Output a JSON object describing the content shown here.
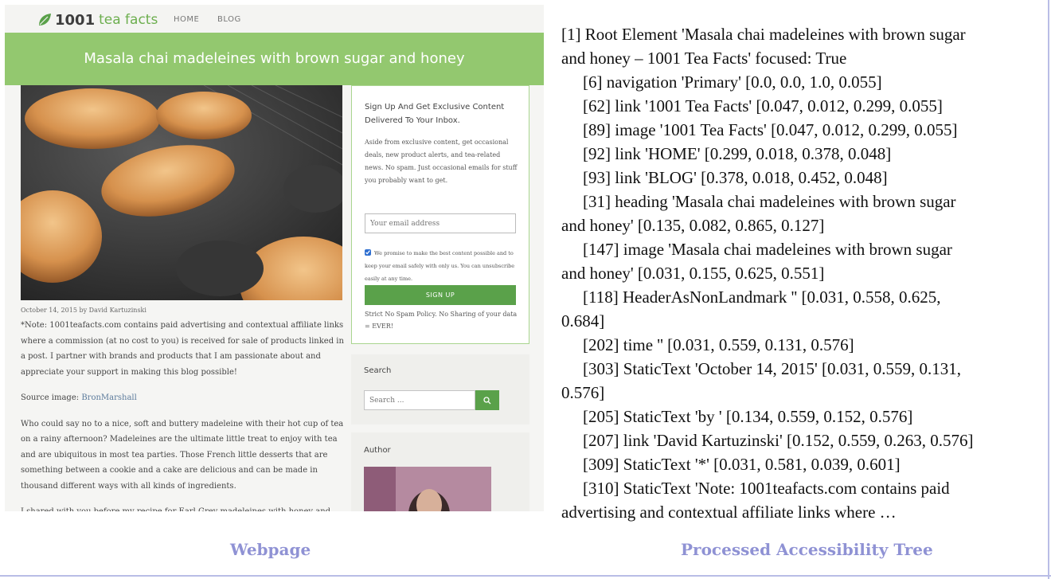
{
  "web": {
    "logo": {
      "number": "1001",
      "word": "tea facts"
    },
    "nav": {
      "home": "HOME",
      "blog": "BLOG"
    },
    "heading": "Masala chai madeleines with brown sugar and honey",
    "meta": {
      "date": "October 14, 2015",
      "by": " by ",
      "author": "David Kartuzinski"
    },
    "article": {
      "note": "*Note: 1001teafacts.com contains paid advertising and contextual affiliate links where a commission (at no cost to you) is received for sale of products linked in a post. I partner with brands and products that I am passionate about and appreciate your support in making this blog possible!",
      "source_label": "Source image: ",
      "source_link": "BronMarshall",
      "p2": "Who could say no to a nice, soft and buttery madeleine with their hot cup of tea on a rainy afternoon? Madeleines are the ultimate little treat to enjoy with tea and are ubiquitous in most tea parties. Those French little desserts that are something between a cookie and a cake are delicious and can be made in thousand different ways with all kinds of ingredients.",
      "p3": "I shared with you before my recipe for Earl Grey madeleines with honey and"
    },
    "signup": {
      "title": "Sign Up And Get Exclusive Content Delivered To Your Inbox.",
      "desc": "Aside from exclusive content, get occasional deals, new product alerts, and tea-related news. No spam. Just occasional emails for stuff you probably want to get.",
      "email_placeholder": "Your email address",
      "consent": "We promise to make the best content possible and to keep your email safely with only us. You can unsubscribe easily at any time.",
      "button": "SIGN UP",
      "spam_note": "Strict No Spam Policy. No Sharing of your data = EVER!"
    },
    "search": {
      "title": "Search",
      "placeholder": "Search ..."
    },
    "author": {
      "title": "Author"
    }
  },
  "captions": {
    "left": "Webpage",
    "right": "Processed Accessibility Tree"
  },
  "tree": {
    "lines": [
      "[1] Root Element 'Masala chai madeleines with brown sugar",
      "and honey – 1001 Tea Facts' focused: True",
      "[6] navigation 'Primary' [0.0, 0.0, 1.0, 0.055]",
      "[62] link '1001 Tea Facts' [0.047, 0.012, 0.299, 0.055]",
      "[89] image '1001 Tea Facts' [0.047, 0.012, 0.299, 0.055]",
      "[92] link 'HOME' [0.299, 0.018, 0.378, 0.048]",
      "[93] link 'BLOG' [0.378, 0.018, 0.452, 0.048]",
      "[31] heading 'Masala chai madeleines with brown sugar",
      "and honey' [0.135, 0.082, 0.865, 0.127]",
      "[147] image 'Masala chai madeleines with brown sugar",
      "and honey' [0.031, 0.155, 0.625, 0.551]",
      "[118] HeaderAsNonLandmark '' [0.031, 0.558, 0.625,",
      "0.684]",
      "[202] time '' [0.031, 0.559, 0.131, 0.576]",
      "[303] StaticText 'October 14, 2015' [0.031, 0.559, 0.131,",
      "0.576]",
      "[205] StaticText 'by ' [0.134, 0.559, 0.152, 0.576]",
      "[207] link 'David Kartuzinski' [0.152, 0.559, 0.263, 0.576]",
      "[309] StaticText '*' [0.031, 0.581, 0.039, 0.601]",
      "[310] StaticText 'Note: 1001teafacts.com contains paid",
      "advertising and contextual affiliate links where …"
    ]
  }
}
